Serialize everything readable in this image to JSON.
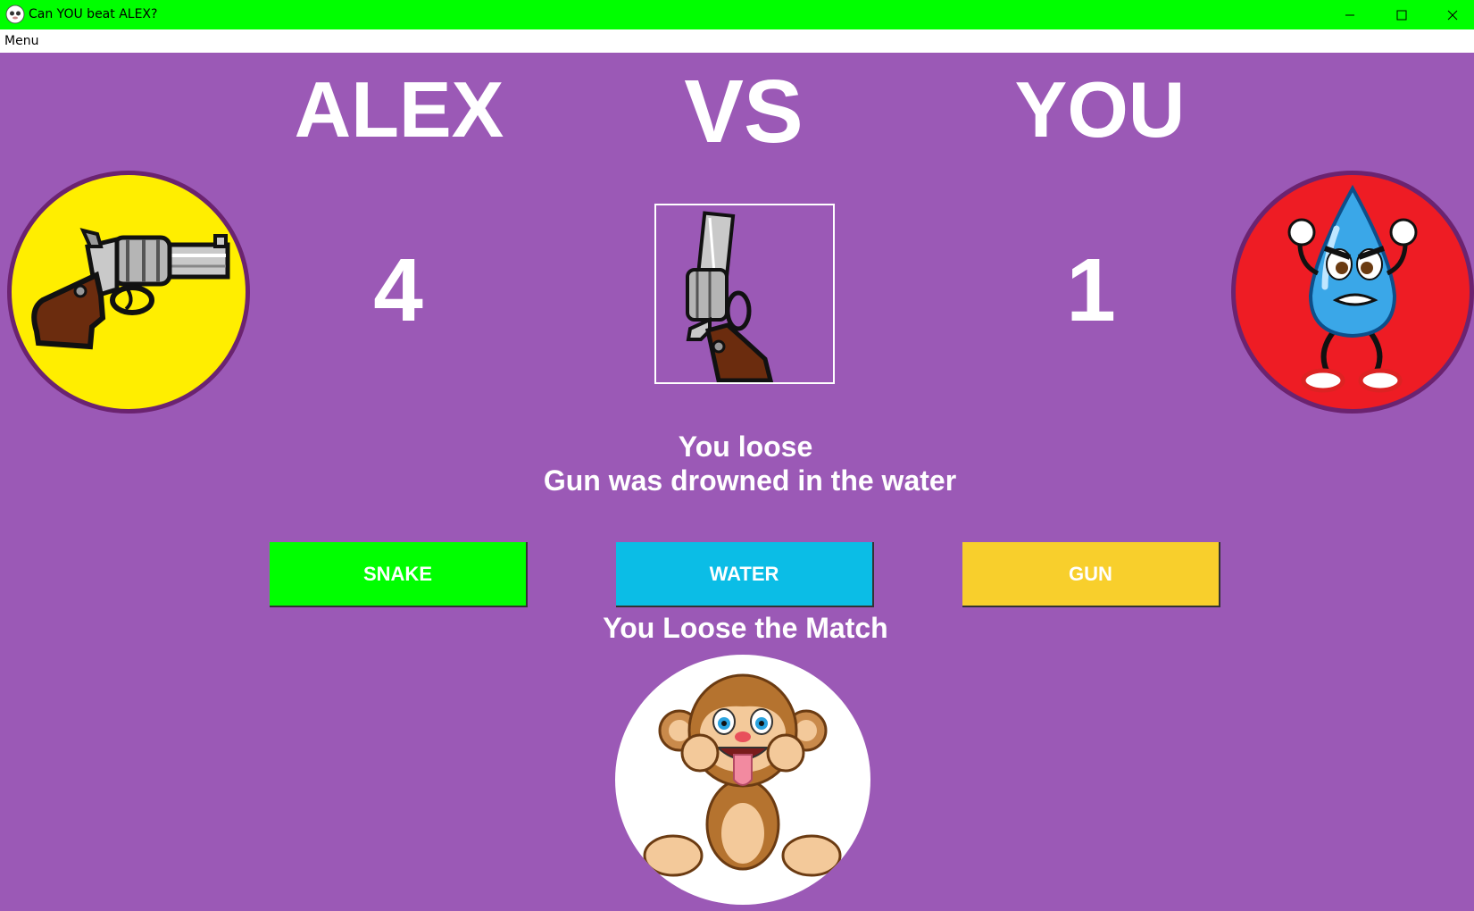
{
  "window": {
    "title": "Can YOU beat ALEX?",
    "titlebar_color": "#00ff00",
    "icons": [
      "app-icon",
      "minimize-icon",
      "maximize-icon",
      "close-icon"
    ]
  },
  "menubar": {
    "items": [
      {
        "label": "Menu"
      }
    ]
  },
  "game": {
    "background_color": "#9b59b6",
    "player_left": {
      "name": "ALEX",
      "score": "4",
      "choice_icon": "gun-icon",
      "avatar_color": "#ffee00"
    },
    "versus_label": "VS",
    "player_right": {
      "name": "YOU",
      "score": "1",
      "choice_icon": "water-drop-icon",
      "avatar_color": "#ee1c24"
    },
    "center_choice_icon": "gun-icon",
    "round_result": "You loose",
    "round_explanation": "Gun was drowned in the water",
    "buttons": [
      {
        "label": "SNAKE",
        "color": "#00ff00"
      },
      {
        "label": "WATER",
        "color": "#0bbde6"
      },
      {
        "label": "GUN",
        "color": "#f8cf2c"
      }
    ],
    "match_result": "You Loose the Match",
    "match_image_icon": "monkey-tongue-icon"
  }
}
